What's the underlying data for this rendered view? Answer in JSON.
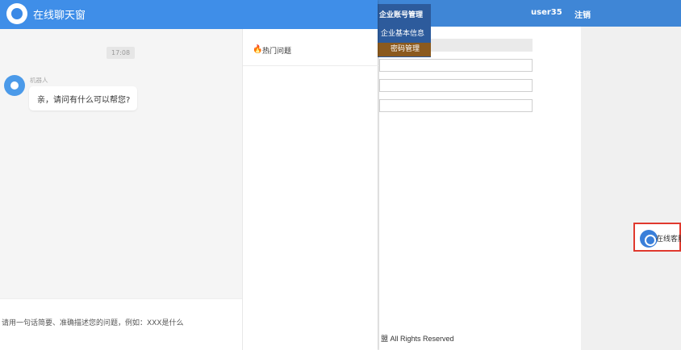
{
  "chat": {
    "title": "在线聊天窗",
    "timestamp": "17:08",
    "bot_name": "机器人",
    "bot_message": "亲，请问有什么可以帮您?",
    "input_placeholder": "请用一句话简要、准确描述您的问题，例如：XXX是什么",
    "hot_questions_label": "热门问题"
  },
  "background_page": {
    "menu_header": "企业账号管理",
    "menu_items": [
      "企业基本信息",
      "密码管理"
    ],
    "user": "user35",
    "logout": "注销",
    "footer": "盟 All Rights Reserved",
    "float_button_label": "在线客服"
  },
  "colors": {
    "chat_header": "#3f8ee8",
    "topbar": "#3f86d6",
    "active_menu": "#8b5a1e",
    "highlight_border": "#e0392e"
  },
  "icons": {
    "chat_logo": "robot-logo-icon",
    "hot": "fire-icon",
    "float": "headset-icon"
  }
}
